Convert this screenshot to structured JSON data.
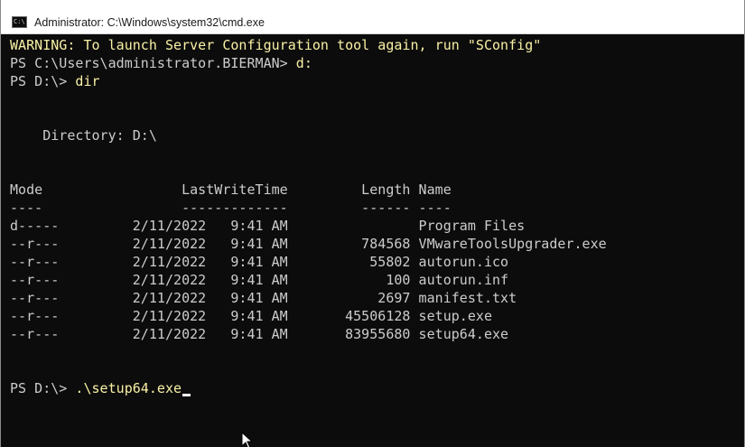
{
  "window": {
    "title": "Administrator: C:\\Windows\\system32\\cmd.exe",
    "icon": "C:\\"
  },
  "console": {
    "warning": "WARNING: To launch Server Configuration tool again, run \"SConfig\"",
    "prompt1": "PS C:\\Users\\administrator.BIERMAN> ",
    "cmd1": "d:",
    "prompt2": "PS D:\\> ",
    "cmd2": "dir",
    "directory": "    Directory: D:\\",
    "header": "Mode                 LastWriteTime         Length Name",
    "separator": "----                 -------------         ------ ----",
    "rows": [
      "d-----         2/11/2022   9:41 AM                Program Files",
      "--r---         2/11/2022   9:41 AM         784568 VMwareToolsUpgrader.exe",
      "--r---         2/11/2022   9:41 AM          55802 autorun.ico",
      "--r---         2/11/2022   9:41 AM            100 autorun.inf",
      "--r---         2/11/2022   9:41 AM           2697 manifest.txt",
      "--r---         2/11/2022   9:41 AM       45506128 setup.exe",
      "--r---         2/11/2022   9:41 AM       83955680 setup64.exe"
    ],
    "prompt3": "PS D:\\> ",
    "cmd3": ".\\setup64.exe"
  },
  "colors": {
    "background": "#0c0c0c",
    "text": "#cccccc",
    "highlight": "#f9f1a5"
  }
}
